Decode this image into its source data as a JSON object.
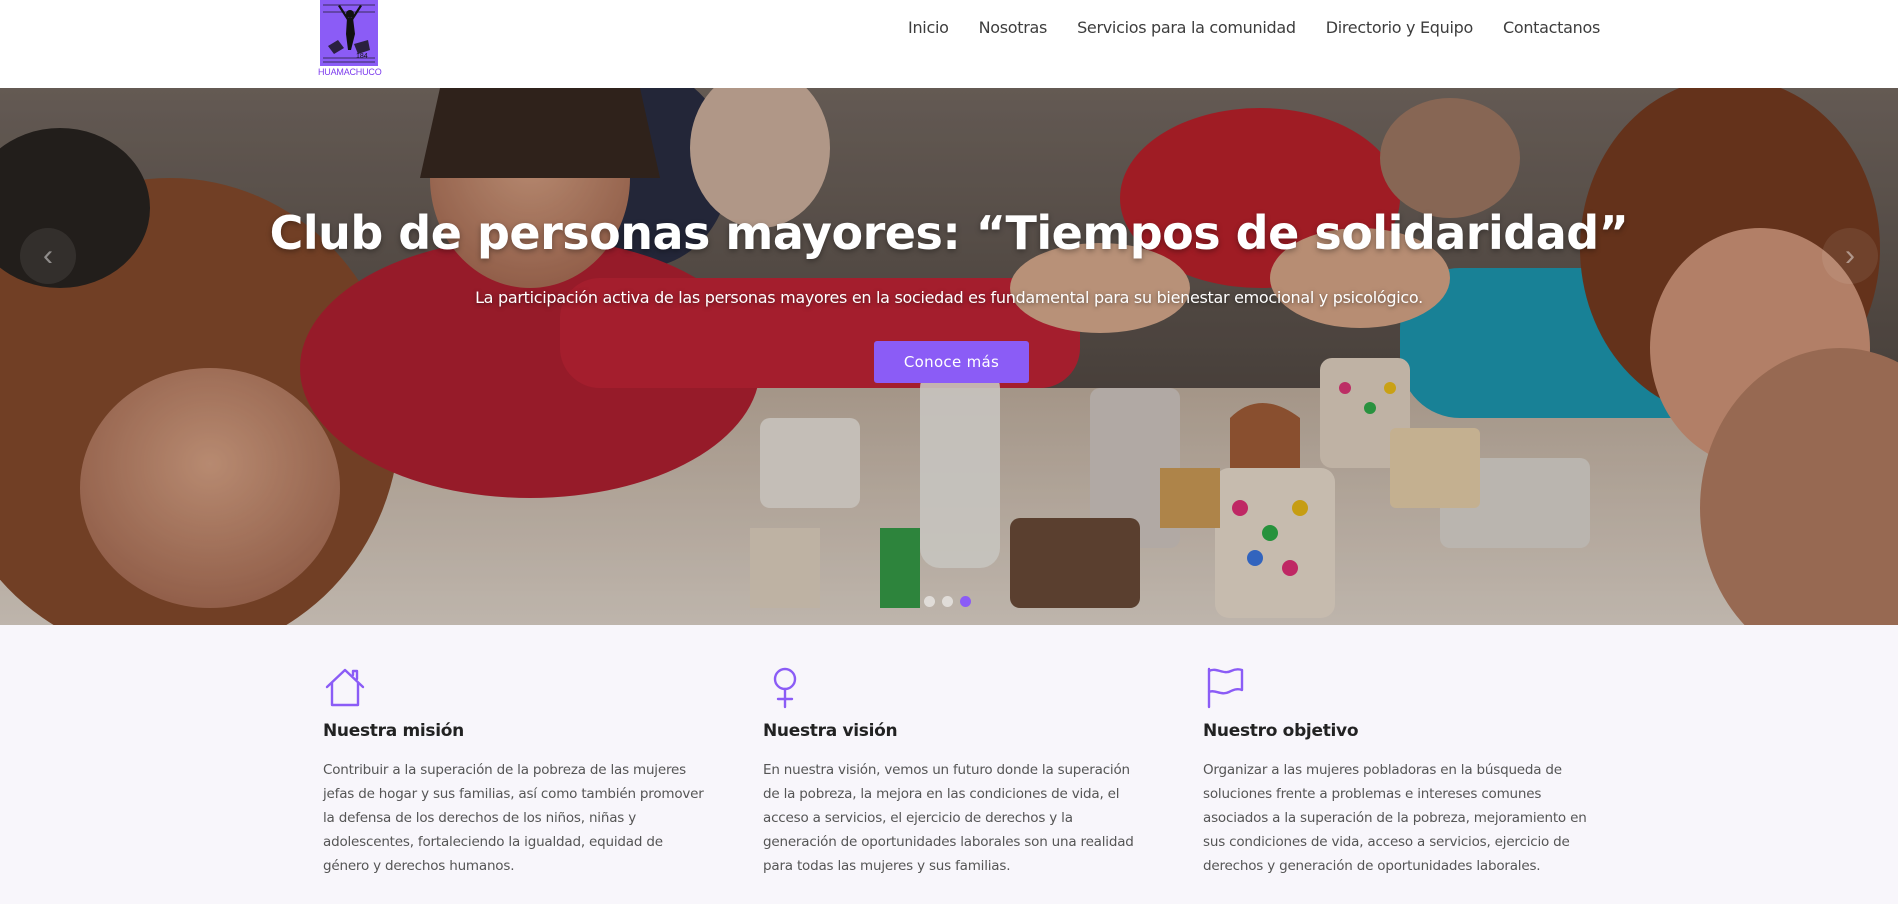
{
  "header": {
    "logo_text": "HUAMACHUCO",
    "nav": [
      "Inicio",
      "Nosotras",
      "Servicios para la comunidad",
      "Directorio y Equipo",
      "Contactanos"
    ]
  },
  "hero": {
    "title": "Club de personas mayores: “Tiempos de solidaridad”",
    "subtitle": "La participación activa de las personas mayores en la sociedad es fundamental para su bienestar emocional y psicológico.",
    "button": "Conoce más",
    "prev_icon": "chevron-left-icon",
    "next_icon": "chevron-right-icon",
    "slides": 3,
    "active_slide": 3
  },
  "features": [
    {
      "icon": "home-icon",
      "title": "Nuestra misión",
      "text": "Contribuir a la superación de la pobreza de las mujeres jefas de hogar y sus familias, así como también promover la defensa de los derechos de los niños, niñas y adolescentes, fortaleciendo la igualdad, equidad de género y derechos humanos."
    },
    {
      "icon": "female-symbol-icon",
      "title": "Nuestra visión",
      "text": "En nuestra visión, vemos un futuro donde la superación de la pobreza, la mejora en las condiciones de vida, el acceso a servicios, el ejercicio de derechos y la generación de oportunidades laborales son una realidad para todas las mujeres y sus familias."
    },
    {
      "icon": "flag-icon",
      "title": "Nuestro objetivo",
      "text": "Organizar a las mujeres pobladoras en la búsqueda de soluciones frente a problemas e intereses comunes asociados a la superación de la pobreza, mejoramiento en sus condiciones de vida, acceso a servicios, ejercicio de derechos y generación de oportunidades laborales."
    }
  ],
  "colors": {
    "accent": "#8b5cf6",
    "features_bg": "#f8f6fb"
  }
}
